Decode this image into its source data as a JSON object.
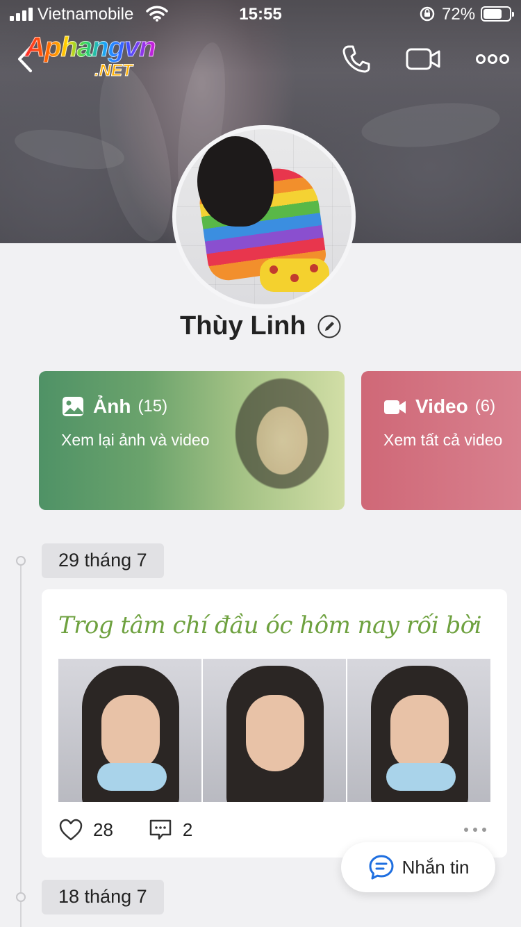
{
  "status_bar": {
    "carrier": "Vietnamobile",
    "time": "15:55",
    "battery": "72%",
    "battery_level": 0.72
  },
  "logo": {
    "main": "Aphangvn",
    "sub": ".NET"
  },
  "profile": {
    "name": "Thùy Linh"
  },
  "media": {
    "photos": {
      "label": "Ảnh",
      "count": "(15)",
      "subtitle": "Xem lại ảnh và video"
    },
    "videos": {
      "label": "Video",
      "count": "(6)",
      "subtitle": "Xem tất cả video"
    }
  },
  "timeline": [
    {
      "date": "29 tháng 7",
      "post": {
        "text": "Trog tâm chí đầu óc hôm nay rối bời",
        "likes": "28",
        "comments": "2"
      }
    },
    {
      "date": "18 tháng 7"
    }
  ],
  "message_button": {
    "label": "Nhắn tin"
  },
  "colors": {
    "accent_blue": "#1f6fe0",
    "title_green": "#6ea13f",
    "photo_card": "#4f9266",
    "video_card": "#cf6877"
  }
}
